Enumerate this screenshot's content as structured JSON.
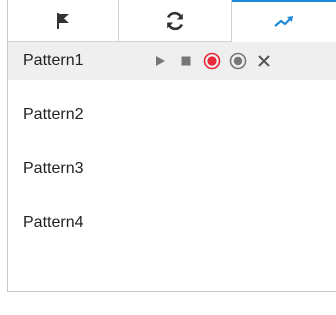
{
  "tabs": [
    {
      "icon": "flag-icon",
      "active": false
    },
    {
      "icon": "refresh-icon",
      "active": false
    },
    {
      "icon": "trend-icon",
      "active": true
    }
  ],
  "colors": {
    "accent": "#1f8ad8",
    "record": "#e8283a",
    "control": "#777777",
    "row_selected": "#efefef"
  },
  "patterns": [
    {
      "label": "Pattern1"
    },
    {
      "label": "Pattern2"
    },
    {
      "label": "Pattern3"
    },
    {
      "label": "Pattern4"
    }
  ],
  "controls": [
    "play-icon",
    "stop-icon",
    "record-icon",
    "stop-record-icon",
    "delete-icon"
  ]
}
